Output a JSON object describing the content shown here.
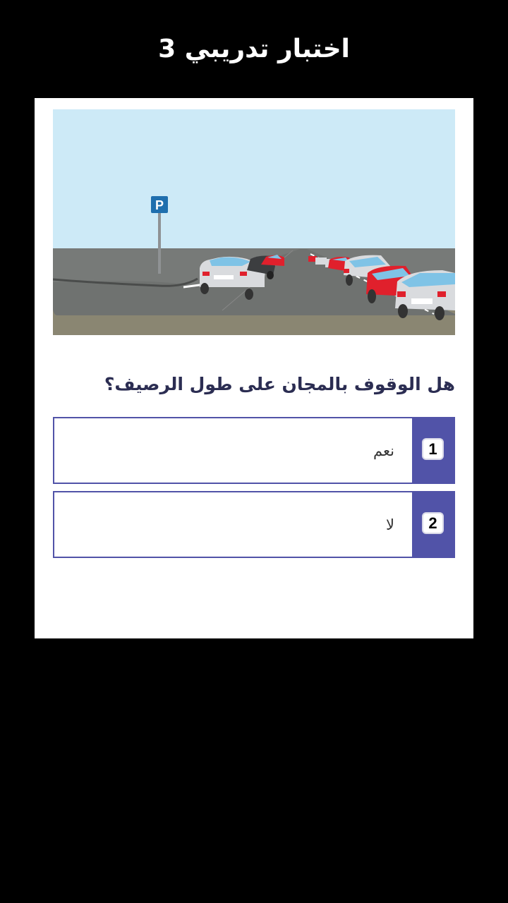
{
  "header": {
    "title": "اختبار تدريبي 3"
  },
  "quiz": {
    "scene": {
      "sign_letter": "P"
    },
    "question": "هل الوقوف بالمجان على طول الرصيف؟",
    "options": [
      {
        "number": "1",
        "label": "نعم"
      },
      {
        "number": "2",
        "label": "لا"
      }
    ]
  },
  "colors": {
    "background": "#000000",
    "card": "#ffffff",
    "accent": "#5153a8",
    "question_text": "#2b2d52",
    "sky": "#cdeaf7",
    "road": "#777a78",
    "sign": "#1f6fae",
    "car_silver": "#d9dbde",
    "car_red": "#e0202c"
  }
}
